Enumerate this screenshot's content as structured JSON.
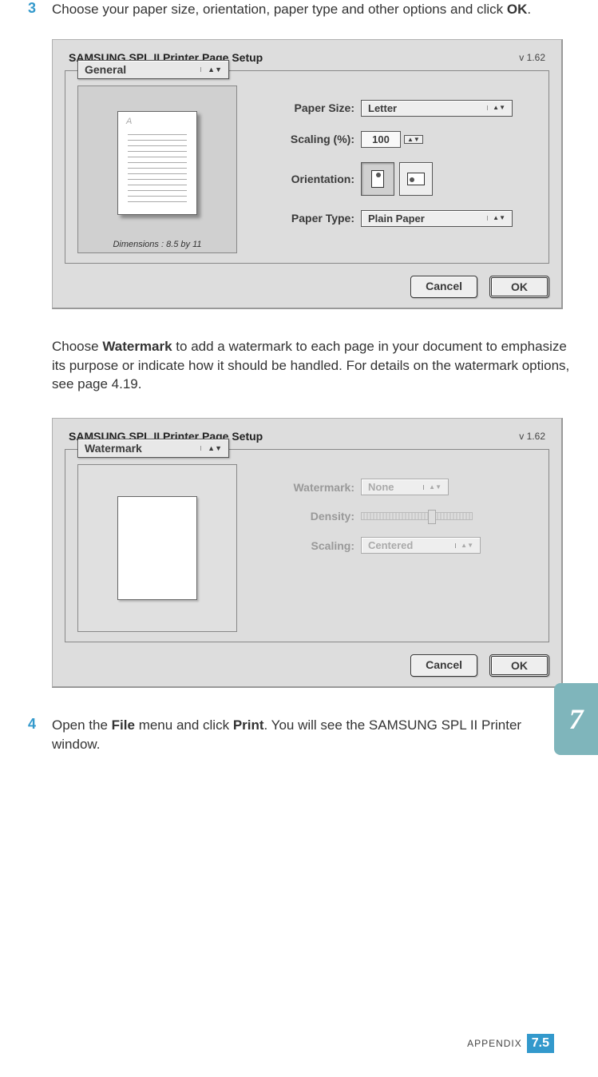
{
  "steps": {
    "s3": {
      "num": "3",
      "text_a": "Choose your paper size, orientation, paper type and other options and click ",
      "text_bold": "OK",
      "text_b": "."
    },
    "watermark_para_a": "Choose ",
    "watermark_bold": "Watermark",
    "watermark_para_b": " to add a watermark to each page in your document to emphasize its purpose or indicate how it should be handled. For details on the watermark options, see page 4.19.",
    "s4": {
      "num": "4",
      "text_a": "Open the ",
      "bold1": "File",
      "text_b": " menu and click ",
      "bold2": "Print",
      "text_c": ". You will see the SAMSUNG SPL II Printer window."
    }
  },
  "dialog1": {
    "title": "SAMSUNG SPL II Printer Page Setup",
    "version": "v 1.62",
    "tab": "General",
    "dims": "Dimensions : 8.5 by 11",
    "labels": {
      "paper_size": "Paper Size:",
      "scaling": "Scaling (%):",
      "orientation": "Orientation:",
      "paper_type": "Paper Type:"
    },
    "values": {
      "paper_size": "Letter",
      "scaling": "100",
      "paper_type": "Plain Paper"
    },
    "buttons": {
      "cancel": "Cancel",
      "ok": "OK"
    }
  },
  "dialog2": {
    "title": "SAMSUNG SPL II Printer Page Setup",
    "version": "v 1.62",
    "tab": "Watermark",
    "labels": {
      "watermark": "Watermark:",
      "density": "Density:",
      "scaling": "Scaling:"
    },
    "values": {
      "watermark": "None",
      "scaling": "Centered"
    },
    "buttons": {
      "cancel": "Cancel",
      "ok": "OK"
    }
  },
  "side_tab": "7",
  "footer": {
    "appendix": "APPENDIX",
    "chapter": "7.",
    "page": "5"
  }
}
